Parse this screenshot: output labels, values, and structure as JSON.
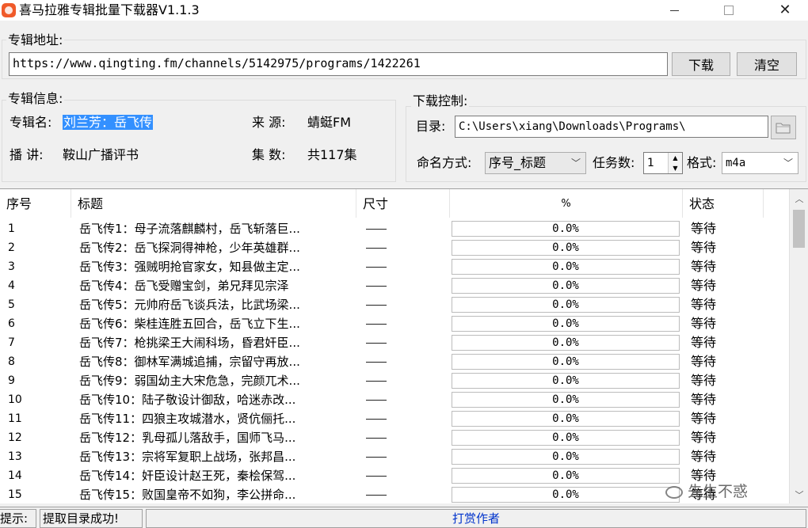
{
  "window": {
    "title": "喜马拉雅专辑批量下载器V1.1.3"
  },
  "url_group": {
    "legend": "专辑地址:",
    "url": "https://www.qingting.fm/channels/5142975/programs/1422261",
    "download_label": "下载",
    "clear_label": "清空"
  },
  "info_group": {
    "legend": "专辑信息:",
    "name_label": "专辑名:",
    "name_value": "刘兰芳：岳飞传",
    "source_label": "来  源:",
    "source_value": "蜻蜓FM",
    "host_label": "播  讲:",
    "host_value": "鞍山广播评书",
    "episodes_label": "集  数:",
    "episodes_value": "共117集"
  },
  "download_group": {
    "legend": "下载控制:",
    "dir_label": "目录:",
    "dir_value": "C:\\Users\\xiang\\Downloads\\Programs\\",
    "naming_label": "命名方式:",
    "naming_value": "序号_标题",
    "tasks_label": "任务数:",
    "tasks_value": "1",
    "format_label": "格式:",
    "format_value": "m4a"
  },
  "table": {
    "headers": {
      "no": "序号",
      "title": "标题",
      "size": "尺寸",
      "pct": "%",
      "state": "状态"
    },
    "rows": [
      {
        "no": "1",
        "title": "岳飞传1：母子流落麒麟村，岳飞斩落巨...",
        "pct": "0.0%",
        "state": "等待"
      },
      {
        "no": "2",
        "title": "岳飞传2：岳飞探洞得神枪，少年英雄群...",
        "pct": "0.0%",
        "state": "等待"
      },
      {
        "no": "3",
        "title": "岳飞传3：强贼明抢官家女，知县做主定...",
        "pct": "0.0%",
        "state": "等待"
      },
      {
        "no": "4",
        "title": "岳飞传4：岳飞受赠宝剑，弟兄拜见宗泽",
        "pct": "0.0%",
        "state": "等待"
      },
      {
        "no": "5",
        "title": "岳飞传5：元帅府岳飞谈兵法，比武场梁...",
        "pct": "0.0%",
        "state": "等待"
      },
      {
        "no": "6",
        "title": "岳飞传6：柴桂连胜五回合，岳飞立下生...",
        "pct": "0.0%",
        "state": "等待"
      },
      {
        "no": "7",
        "title": "岳飞传7：枪挑梁王大闹科场，昏君奸臣...",
        "pct": "0.0%",
        "state": "等待"
      },
      {
        "no": "8",
        "title": "岳飞传8：御林军满城追捕，宗留守再放...",
        "pct": "0.0%",
        "state": "等待"
      },
      {
        "no": "9",
        "title": "岳飞传9：弱国幼主大宋危急，完颜兀术...",
        "pct": "0.0%",
        "state": "等待"
      },
      {
        "no": "10",
        "title": "岳飞传10：陆子敬设计御敌，哈迷赤改...",
        "pct": "0.0%",
        "state": "等待"
      },
      {
        "no": "11",
        "title": "岳飞传11：四狼主攻城潜水，贤伉俪托...",
        "pct": "0.0%",
        "state": "等待"
      },
      {
        "no": "12",
        "title": "岳飞传12：乳母孤儿落敌手，国师飞马...",
        "pct": "0.0%",
        "state": "等待"
      },
      {
        "no": "13",
        "title": "岳飞传13：宗将军复职上战场，张邦昌...",
        "pct": "0.0%",
        "state": "等待"
      },
      {
        "no": "14",
        "title": "岳飞传14：奸臣设计赵王死，秦桧保驾...",
        "pct": "0.0%",
        "state": "等待"
      },
      {
        "no": "15",
        "title": "岳飞传15：败国皇帝不如狗，李公拼命...",
        "pct": "0.0%",
        "state": "等待"
      }
    ]
  },
  "statusbar": {
    "hint_label": "提示:",
    "hint_value": "提取目录成功!",
    "tip_link": "打赏作者"
  },
  "watermark": {
    "text": "先生不惑"
  }
}
